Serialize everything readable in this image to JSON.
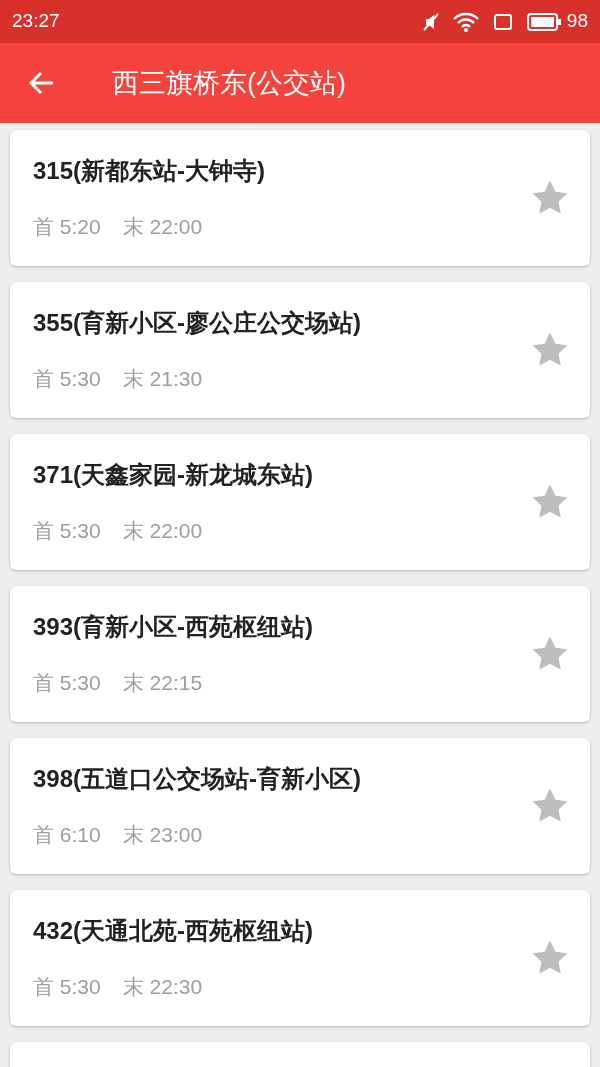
{
  "status_bar": {
    "time": "23:27",
    "battery": "98"
  },
  "header": {
    "title": "西三旗桥东(公交站)"
  },
  "routes": [
    {
      "title": "315(新都东站-大钟寺)",
      "first": "首 5:20",
      "last": "末 22:00",
      "starred": false
    },
    {
      "title": "355(育新小区-廖公庄公交场站)",
      "first": "首 5:30",
      "last": "末 21:30",
      "starred": false
    },
    {
      "title": "371(天鑫家园-新龙城东站)",
      "first": "首 5:30",
      "last": "末 22:00",
      "starred": false
    },
    {
      "title": "393(育新小区-西苑枢纽站)",
      "first": "首 5:30",
      "last": "末 22:15",
      "starred": false
    },
    {
      "title": "398(五道口公交场站-育新小区)",
      "first": "首 6:10",
      "last": "末 23:00",
      "starred": false
    },
    {
      "title": "432(天通北苑-西苑枢纽站)",
      "first": "首 5:30",
      "last": "末 22:30",
      "starred": false
    }
  ]
}
